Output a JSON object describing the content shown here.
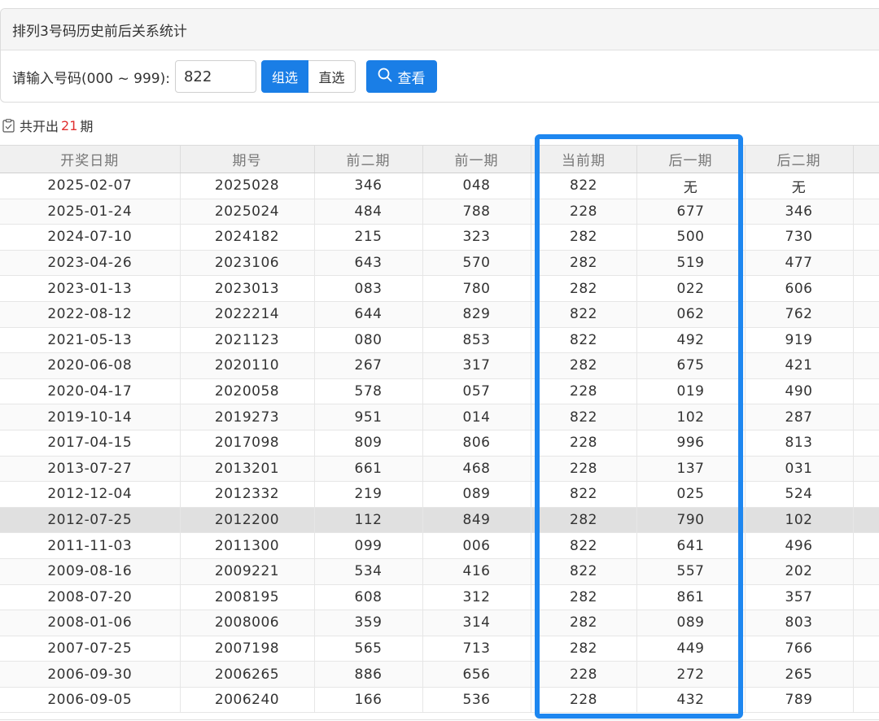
{
  "panel": {
    "title": "排列3号码历史前后关系统计",
    "input_label": "请输入号码(000 ~ 999):",
    "input_value": "822",
    "mode_group": "组选",
    "mode_direct": "直选",
    "search_label": "查看"
  },
  "summary": {
    "prefix": "共开出",
    "count": "21",
    "suffix": "期"
  },
  "table": {
    "headers": [
      "开奖日期",
      "期号",
      "前二期",
      "前一期",
      "当前期",
      "后一期",
      "后二期"
    ],
    "rows": [
      [
        "2025-02-07",
        "2025028",
        "346",
        "048",
        "822",
        "无",
        "无"
      ],
      [
        "2025-01-24",
        "2025024",
        "484",
        "788",
        "228",
        "677",
        "346"
      ],
      [
        "2024-07-10",
        "2024182",
        "215",
        "323",
        "282",
        "500",
        "730"
      ],
      [
        "2023-04-26",
        "2023106",
        "643",
        "570",
        "282",
        "519",
        "477"
      ],
      [
        "2023-01-13",
        "2023013",
        "083",
        "780",
        "282",
        "022",
        "606"
      ],
      [
        "2022-08-12",
        "2022214",
        "644",
        "829",
        "822",
        "062",
        "762"
      ],
      [
        "2021-05-13",
        "2021123",
        "080",
        "853",
        "822",
        "492",
        "919"
      ],
      [
        "2020-06-08",
        "2020110",
        "267",
        "317",
        "282",
        "675",
        "421"
      ],
      [
        "2020-04-17",
        "2020058",
        "578",
        "057",
        "228",
        "019",
        "490"
      ],
      [
        "2019-10-14",
        "2019273",
        "951",
        "014",
        "822",
        "102",
        "287"
      ],
      [
        "2017-04-15",
        "2017098",
        "809",
        "806",
        "228",
        "996",
        "813"
      ],
      [
        "2013-07-27",
        "2013201",
        "661",
        "468",
        "228",
        "137",
        "031"
      ],
      [
        "2012-12-04",
        "2012332",
        "219",
        "089",
        "822",
        "025",
        "524"
      ],
      [
        "2012-07-25",
        "2012200",
        "112",
        "849",
        "282",
        "790",
        "102"
      ],
      [
        "2011-11-03",
        "2011300",
        "099",
        "006",
        "822",
        "641",
        "496"
      ],
      [
        "2009-08-16",
        "2009221",
        "534",
        "416",
        "822",
        "557",
        "202"
      ],
      [
        "2008-07-20",
        "2008195",
        "608",
        "312",
        "282",
        "861",
        "357"
      ],
      [
        "2008-01-06",
        "2008006",
        "359",
        "314",
        "282",
        "089",
        "803"
      ],
      [
        "2007-07-25",
        "2007198",
        "565",
        "713",
        "282",
        "449",
        "766"
      ],
      [
        "2006-09-30",
        "2006265",
        "886",
        "656",
        "228",
        "272",
        "265"
      ],
      [
        "2006-09-05",
        "2006240",
        "166",
        "536",
        "228",
        "432",
        "789"
      ]
    ],
    "highlighted_row_index": 13
  },
  "colors": {
    "accent": "#1a7ee6",
    "highlight_box": "#1e87f0",
    "count_red": "#e03030"
  },
  "icons": {
    "search": "search-icon",
    "summary": "clipboard-check-icon"
  }
}
